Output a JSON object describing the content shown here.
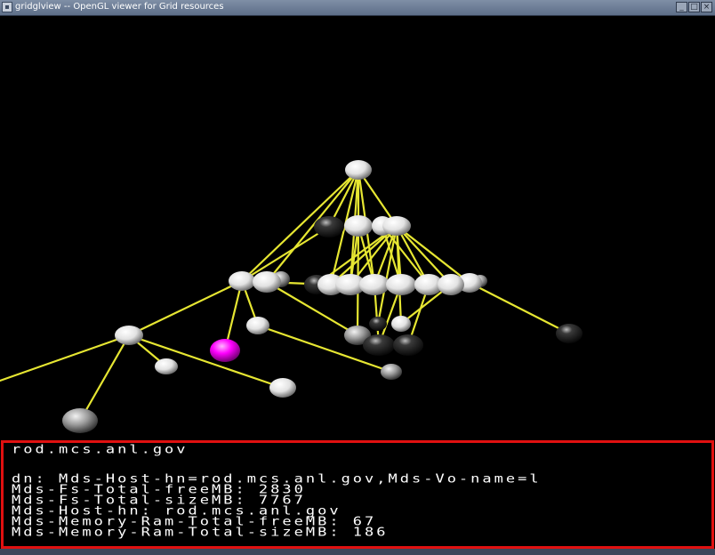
{
  "window": {
    "title": "gridglview -- OpenGL viewer for Grid resources",
    "buttons": {
      "minimize": "_",
      "maximize": "□",
      "close": "×"
    }
  },
  "scene": {
    "edge_color": "#e6e632",
    "highlight_node_color": "#ff00ff",
    "node_colors": [
      "white",
      "dark",
      "grey"
    ]
  },
  "info_panel": {
    "border_color": "#e01010",
    "lines": [
      "rod.mcs.anl.gov",
      "",
      "dn: Mds-Host-hn=rod.mcs.anl.gov,Mds-Vo-name=l",
      "Mds-Fs-Total-freeMB: 2830",
      "Mds-Fs-Total-sizeMB: 7767",
      "Mds-Host-hn: rod.mcs.anl.gov",
      "Mds-Memory-Ram-Total-freeMB: 67",
      "Mds-Memory-Ram-Total-sizeMB: 186"
    ]
  }
}
